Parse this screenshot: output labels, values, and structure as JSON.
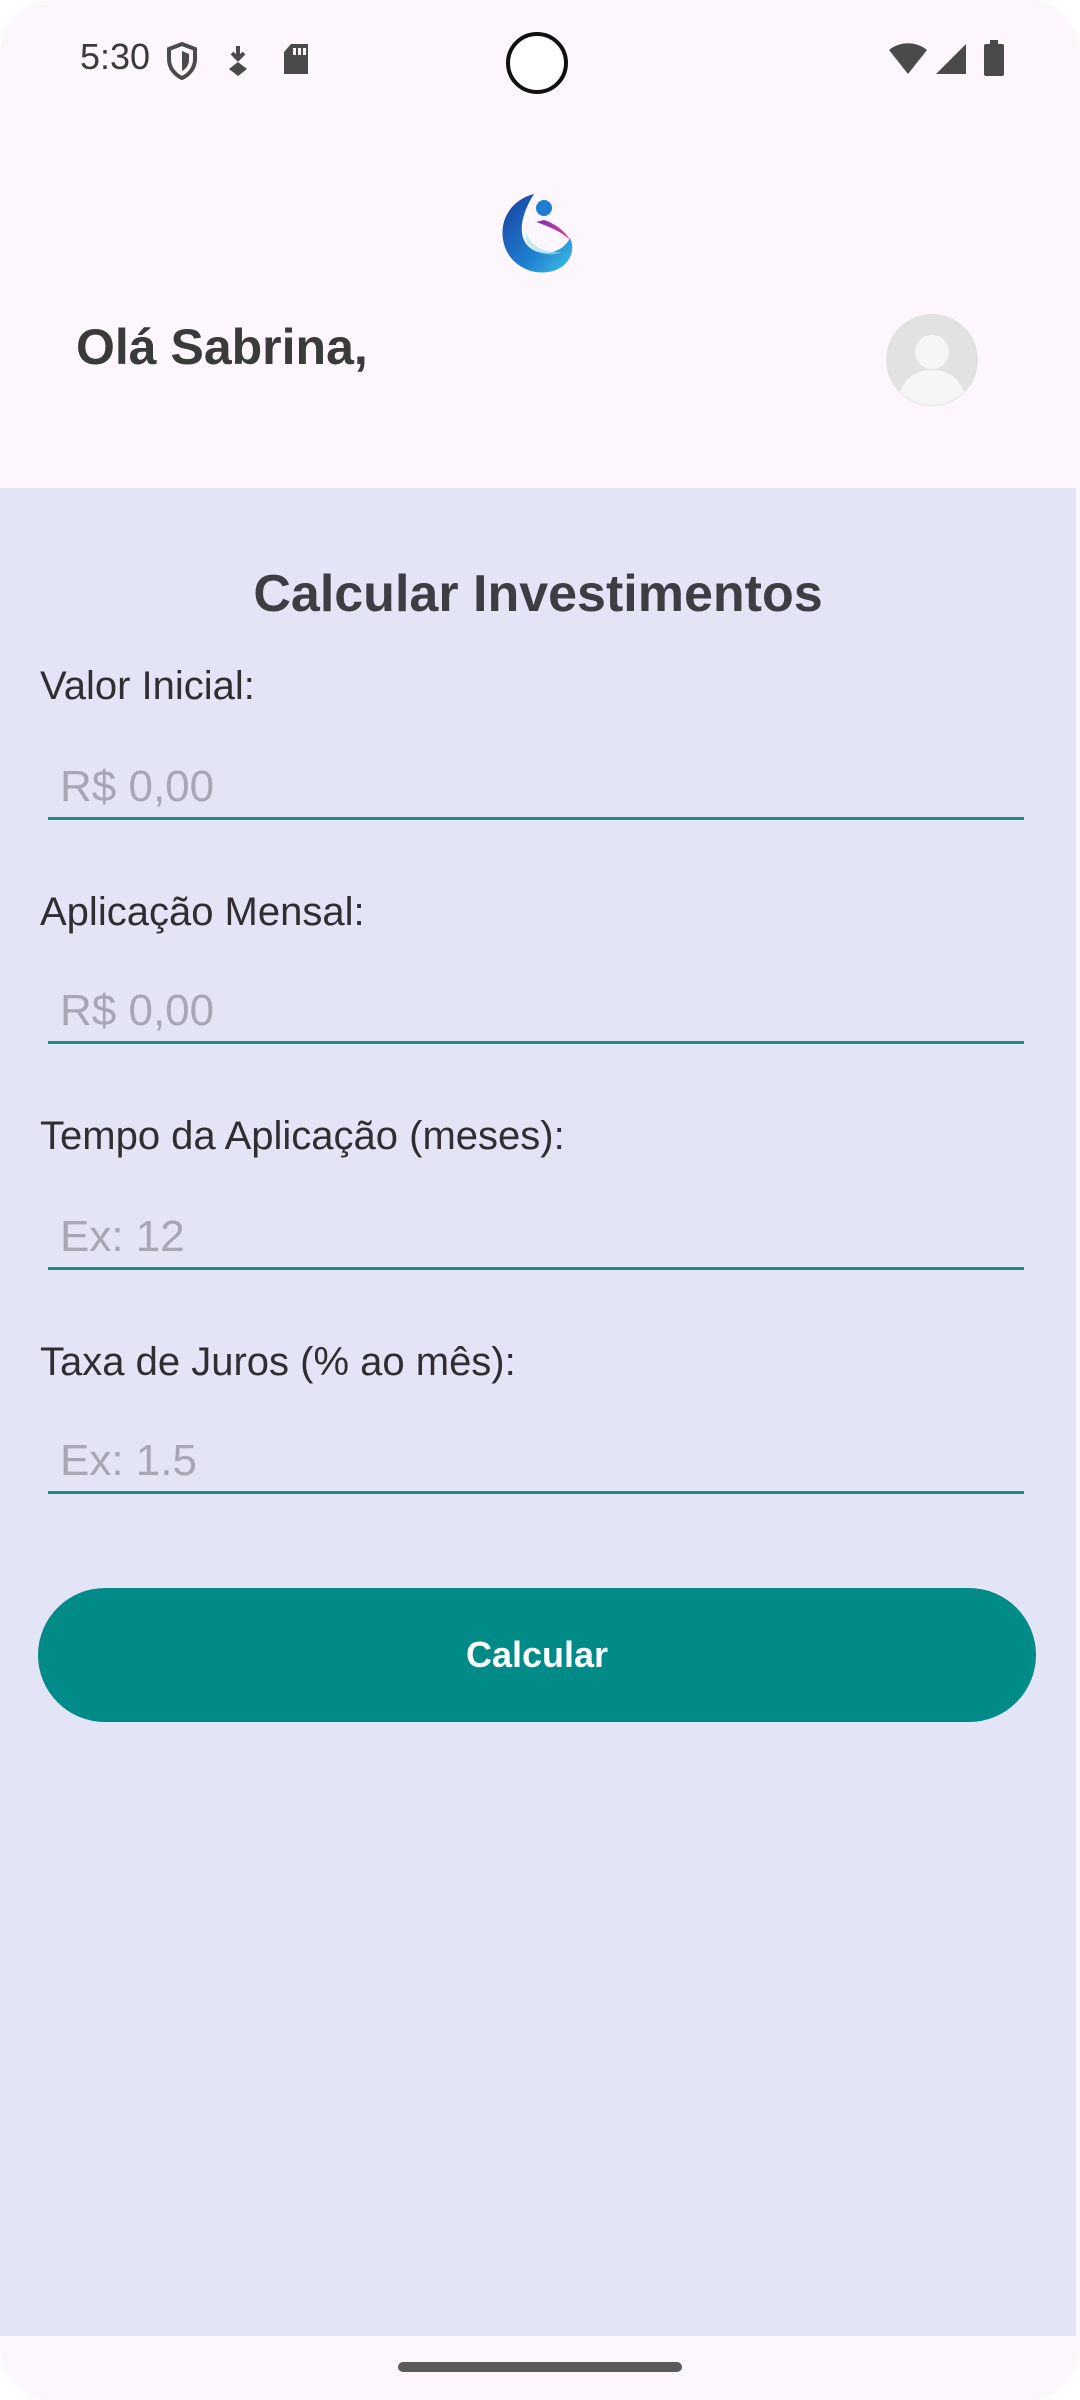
{
  "status_bar": {
    "time": "5:30",
    "left_icons": [
      "shield-icon",
      "download-icon",
      "sd-card-icon"
    ],
    "right_icons": [
      "wifi-icon",
      "cellular-signal-icon",
      "battery-icon"
    ]
  },
  "header": {
    "logo": "app-logo",
    "greeting": "Olá Sabrina,",
    "avatar": "user-avatar-icon"
  },
  "form": {
    "title": "Calcular Investimentos",
    "fields": [
      {
        "label": "Valor Inicial:",
        "placeholder": "R$ 0,00",
        "value": ""
      },
      {
        "label": "Aplicação Mensal:",
        "placeholder": "R$ 0,00",
        "value": ""
      },
      {
        "label": "Tempo da Aplicação (meses):",
        "placeholder": "Ex: 12",
        "value": ""
      },
      {
        "label": "Taxa de Juros (% ao mês):",
        "placeholder": "Ex: 1.5",
        "value": ""
      }
    ],
    "submit_label": "Calcular"
  },
  "colors": {
    "accent": "#008b88",
    "underline": "#1f8a84",
    "content_bg": "#e4e4f7",
    "header_bg": "#fdf6fc"
  }
}
